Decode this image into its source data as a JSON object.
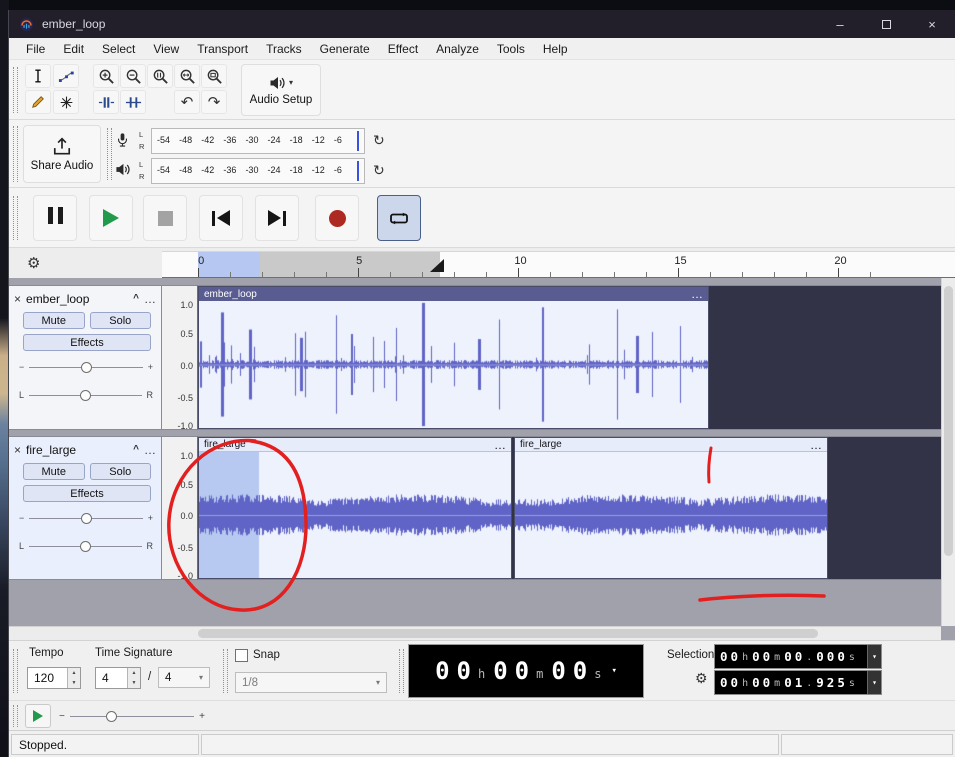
{
  "window": {
    "title": "ember_loop"
  },
  "menu": {
    "items": [
      "File",
      "Edit",
      "Select",
      "View",
      "Transport",
      "Tracks",
      "Generate",
      "Effect",
      "Analyze",
      "Tools",
      "Help"
    ]
  },
  "glyphs": {
    "dropdown": "▾",
    "spin_up": "▲",
    "spin_down": "▼",
    "gear": "⚙",
    "undo": "↶",
    "redo": "↷",
    "refresh": "↻",
    "close": "×",
    "collapse": "^",
    "more": "…",
    "minus": "−",
    "plus": "+",
    "minimize": "–"
  },
  "toolbars": {
    "audio_setup_label": "Audio Setup",
    "share_audio_label": "Share Audio",
    "meter": {
      "left": "L",
      "right": "R",
      "db": [
        "-54",
        "-48",
        "-42",
        "-36",
        "-30",
        "-24",
        "-18",
        "-12",
        "-6"
      ]
    }
  },
  "timeline": {
    "ticks": [
      "0",
      "5",
      "10",
      "15",
      "20"
    ]
  },
  "tracks": [
    {
      "name": "ember_loop",
      "mute": "Mute",
      "solo": "Solo",
      "effects": "Effects",
      "pan_left": "L",
      "pan_right": "R",
      "ruler": [
        "1.0",
        "0.5",
        "0.0",
        "-0.5",
        "-1.0"
      ],
      "clips": [
        {
          "title": "ember_loop"
        }
      ]
    },
    {
      "name": "fire_large",
      "mute": "Mute",
      "solo": "Solo",
      "effects": "Effects",
      "pan_left": "L",
      "pan_right": "R",
      "ruler": [
        "1.0",
        "0.5",
        "0.0",
        "-0.5",
        "-1.0"
      ],
      "clips": [
        {
          "title": "fire_large"
        },
        {
          "title": "fire_large"
        }
      ]
    }
  ],
  "bottom": {
    "tempo_label": "Tempo",
    "tempo_value": "120",
    "time_signature_label": "Time Signature",
    "beats": "4",
    "slash": "/",
    "beat_unit": "4",
    "snap_label": "Snap",
    "snap_value": "1/8",
    "time": {
      "h": "00",
      "m": "00",
      "s": "00"
    },
    "units": {
      "h": "h",
      "m": "m",
      "s": "s",
      "dot": "."
    },
    "selection_label": "Selection",
    "sel_start": {
      "h": "00",
      "m": "00",
      "s": "00",
      "ms": "000"
    },
    "sel_end": {
      "h": "00",
      "m": "00",
      "s": "01",
      "ms": "925"
    }
  },
  "status": {
    "text": "Stopped."
  },
  "colors": {
    "waveform": "#6064c6",
    "selection": "#b7c9f0",
    "record_red": "#ad2a23",
    "play_green": "#219a4b",
    "loop_active_bg": "#ccd7eb",
    "titlebar": "#221f2b"
  },
  "waveforms": {
    "ember": {
      "kind": "ember",
      "seed": 11,
      "bg": "#eef2fd",
      "color": "#6064c6",
      "zero": "#9aa0dd",
      "spikes": [
        [
          0.045,
          0.82
        ],
        [
          0.1,
          0.55
        ],
        [
          0.2,
          0.42
        ],
        [
          0.3,
          0.48
        ],
        [
          0.44,
          0.97
        ],
        [
          0.55,
          0.4
        ],
        [
          0.675,
          0.9
        ],
        [
          0.86,
          0.45
        ]
      ]
    },
    "fire1": {
      "kind": "noise",
      "seed": 29,
      "bg": "#eef2fd",
      "color": "#6064c6",
      "zero": "#9aa0dd",
      "selEnd": 60,
      "selBg": "#b7c9f0"
    },
    "fire2": {
      "kind": "noise",
      "seed": 53,
      "bg": "#eef2fd",
      "color": "#6064c6",
      "zero": "#9aa0dd"
    }
  }
}
